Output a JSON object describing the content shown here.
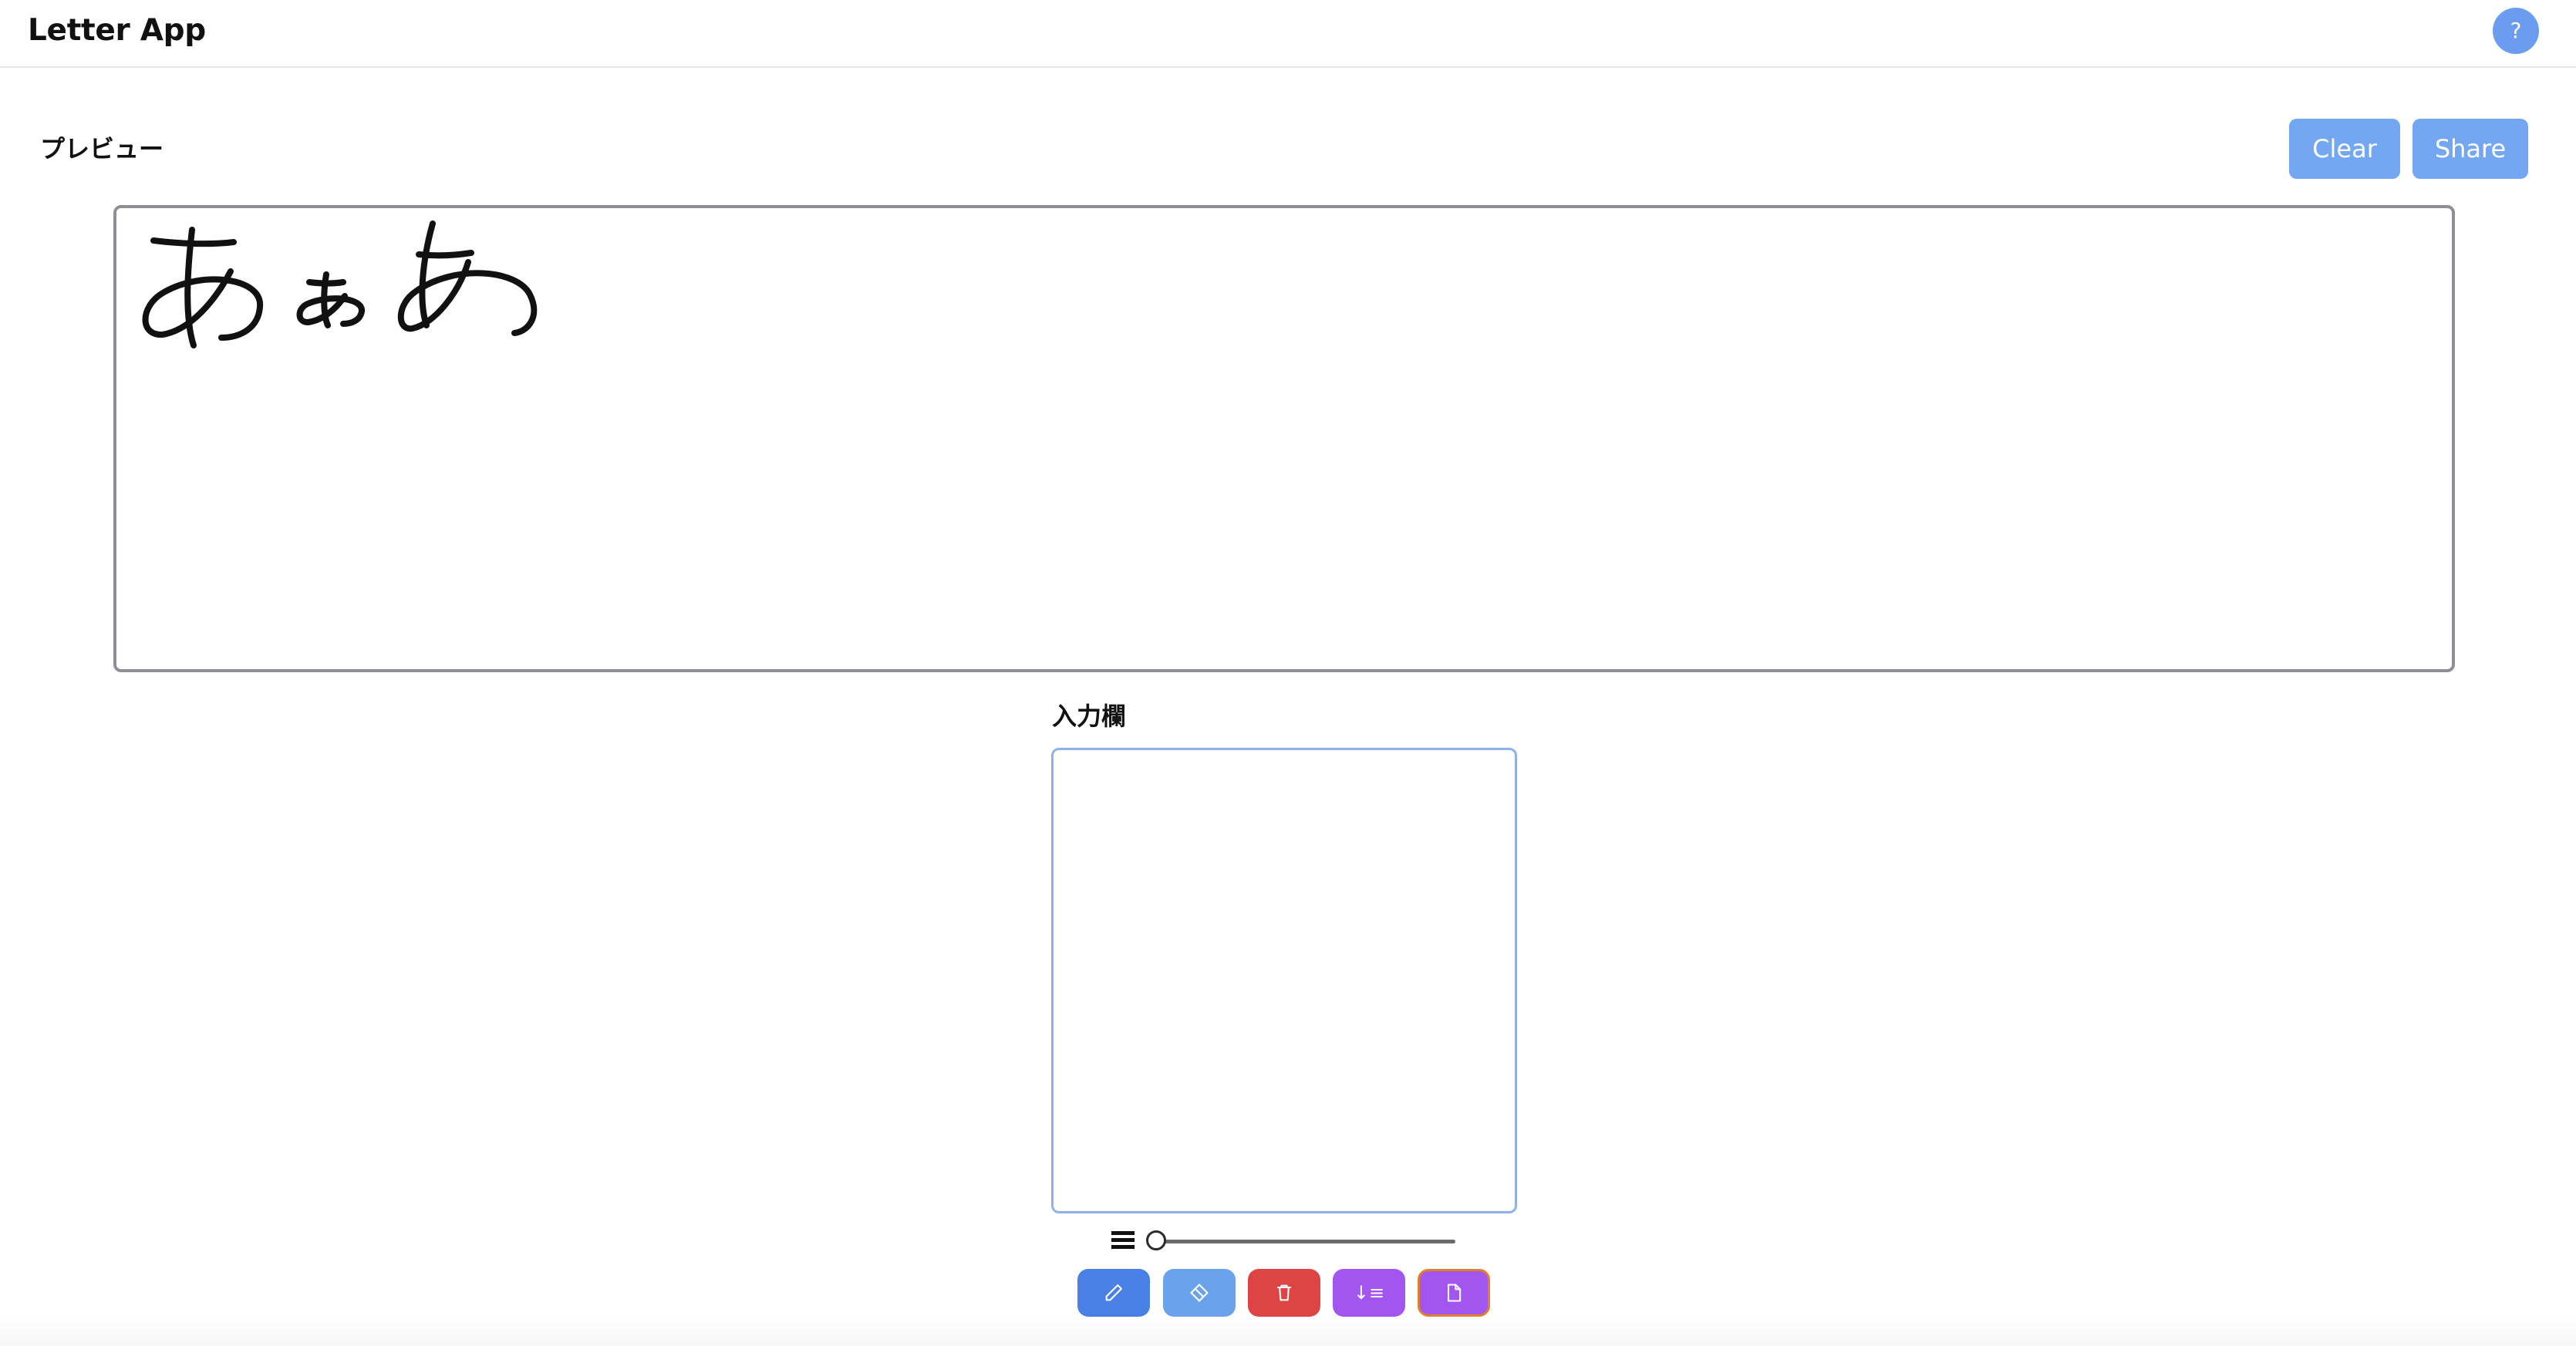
{
  "header": {
    "title": "Letter App",
    "help_label": "?"
  },
  "preview": {
    "label": "プレビュー",
    "clear_label": "Clear",
    "share_label": "Share",
    "handwritten_content": "あぁあ"
  },
  "input": {
    "label": "入力欄"
  },
  "toolbar": {
    "stroke_width_icon": "lines-icon",
    "stroke_width_level": 0,
    "tools": [
      {
        "icon": "pencil-icon",
        "color": "#4a7fe6"
      },
      {
        "icon": "eraser-icon",
        "color": "#6aa2ec"
      },
      {
        "icon": "trash-icon",
        "color": "#dd4545"
      },
      {
        "icon": "insert-line-icon",
        "glyph": "↓≡",
        "color": "#a355ef"
      },
      {
        "icon": "document-icon",
        "color": "#a355ef",
        "selected": true
      }
    ]
  },
  "colors": {
    "accent": "#74a7f2",
    "help": "#6b9cf0",
    "danger": "#dd4545",
    "purple": "#a355ef",
    "selected_outline": "#e0802c"
  }
}
